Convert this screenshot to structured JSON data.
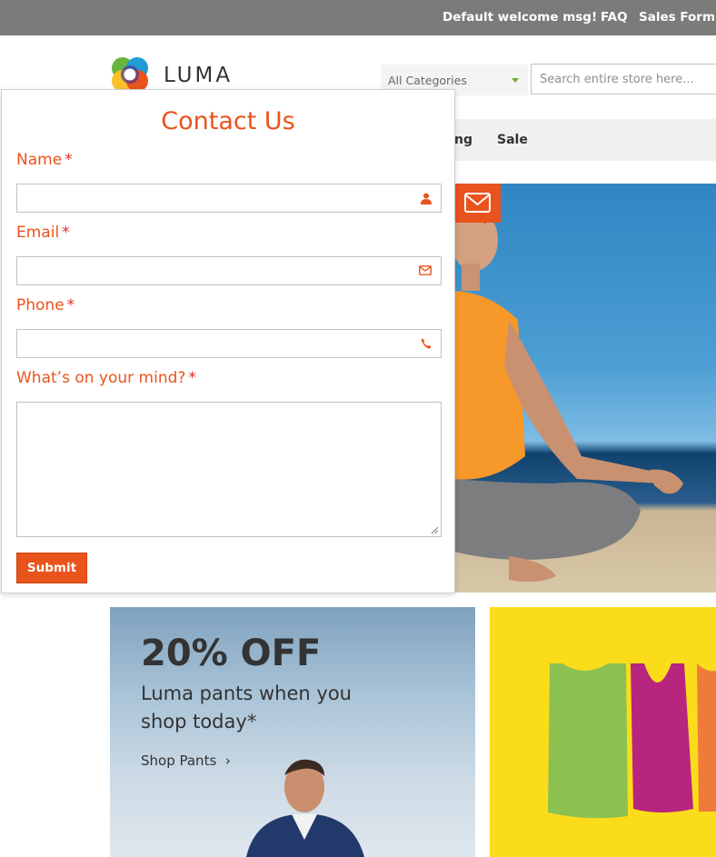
{
  "header": {
    "welcome": "Default welcome msg!",
    "faq": "FAQ",
    "sales_form": "Sales Form"
  },
  "logo": {
    "text": "LUMA"
  },
  "search": {
    "category": "All Categories",
    "placeholder": "Search entire store here..."
  },
  "nav": {
    "partial": "ng",
    "sale": "Sale"
  },
  "contact_form": {
    "title": "Contact Us",
    "required_marker": "*",
    "fields": [
      {
        "label": "Name",
        "icon": "user-icon",
        "value": ""
      },
      {
        "label": "Email",
        "icon": "envelope-icon",
        "value": ""
      },
      {
        "label": "Phone",
        "icon": "phone-icon",
        "value": ""
      },
      {
        "label": "What’s on your mind?",
        "icon": "",
        "value": ""
      }
    ],
    "submit": "Submit"
  },
  "promo_pants": {
    "headline": "20% OFF",
    "text": "Luma pants when you shop today*",
    "link": "Shop Pants",
    "link_chevron": "›"
  },
  "colors": {
    "accent": "#e9531c",
    "required": "#e02b27",
    "topbar": "#7b7c79",
    "promo_yellow": "#fbdc1b"
  }
}
